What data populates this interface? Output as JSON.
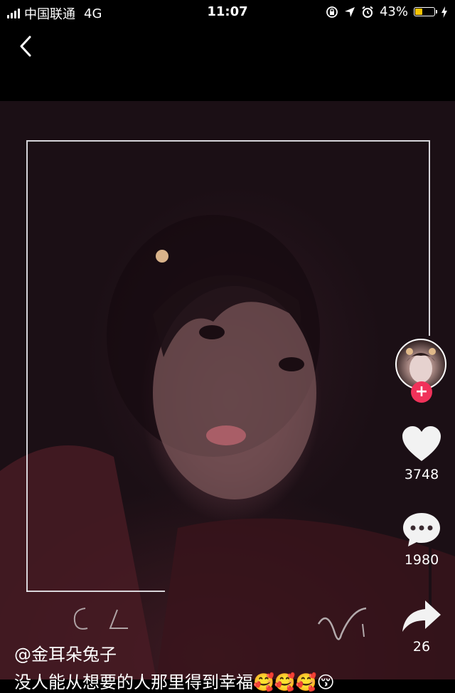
{
  "status_bar": {
    "carrier": "中国联通",
    "network": "4G",
    "time": "11:07",
    "battery_percent": "43%",
    "battery_level": 0.43,
    "battery_color": "#f5c400"
  },
  "nav": {
    "back_icon": "chevron-left-icon"
  },
  "video": {
    "watermark_left": "G A",
    "watermark_right": "V"
  },
  "rail": {
    "follow_label": "+",
    "likes": "3748",
    "comments": "1980",
    "shares": "26",
    "accent": "#f0325a"
  },
  "post": {
    "username": "@金耳朵兔子",
    "caption": "没人能从想要的人那里得到幸福🥰🥰🥰😚"
  }
}
